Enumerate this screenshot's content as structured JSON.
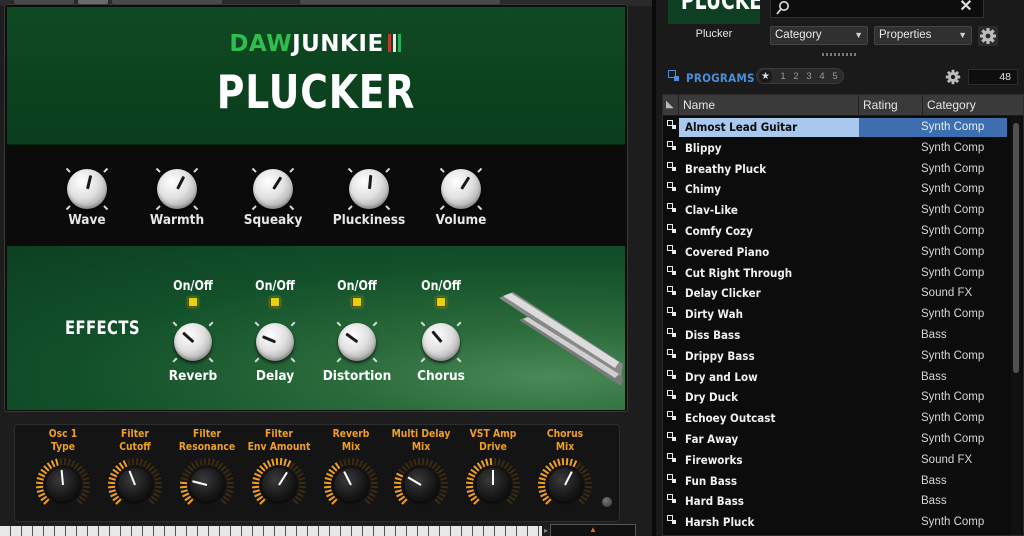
{
  "instrument": {
    "brand": {
      "part1": "DAW",
      "part2": "JUNKIE",
      "bar_colors": [
        "#c0392b",
        "#e8e8e8",
        "#27ae60"
      ]
    },
    "title": "PLUCKER",
    "main_knobs": [
      {
        "label": "Wave",
        "value": 0.55
      },
      {
        "label": "Warmth",
        "value": 0.6
      },
      {
        "label": "Squeaky",
        "value": 0.62
      },
      {
        "label": "Pluckiness",
        "value": 0.52
      },
      {
        "label": "Volume",
        "value": 0.62
      }
    ],
    "effects": {
      "title": "EFFECTS",
      "onoff_label": "On/Off",
      "units": [
        {
          "label": "Reverb",
          "value": 0.32
        },
        {
          "label": "Delay",
          "value": 0.25
        },
        {
          "label": "Distortion",
          "value": 0.3
        },
        {
          "label": "Chorus",
          "value": 0.35
        }
      ]
    },
    "bottom_knobs": [
      {
        "line1": "Osc 1",
        "line2": "Type",
        "value": 0.48
      },
      {
        "line1": "Filter",
        "line2": "Cutoff",
        "value": 0.42
      },
      {
        "line1": "Filter",
        "line2": "Resonance",
        "value": 0.22
      },
      {
        "line1": "Filter",
        "line2": "Env Amount",
        "value": 0.62
      },
      {
        "line1": "Reverb",
        "line2": "Mix",
        "value": 0.4
      },
      {
        "line1": "Multi Delay",
        "line2": "Mix",
        "value": 0.28
      },
      {
        "line1": "VST Amp",
        "line2": "Drive",
        "value": 0.5
      },
      {
        "line1": "Chorus",
        "line2": "Mix",
        "value": 0.6
      }
    ],
    "colors": {
      "accent_orange": "#f0a020",
      "led_yellow": "#e6d20a"
    }
  },
  "browser": {
    "preview_title": "PLUCKER",
    "preview_name": "Plucker",
    "search": {
      "value": "",
      "placeholder": ""
    },
    "filters": {
      "category": "Category",
      "properties": "Properties"
    },
    "programs_label": "PROGRAMS",
    "rating_filter": [
      "1",
      "2",
      "3",
      "4",
      "5"
    ],
    "program_count": "48",
    "columns": {
      "name": "Name",
      "rating": "Rating",
      "category": "Category"
    },
    "programs": [
      {
        "name": "Almost Lead Guitar",
        "category": "Synth Comp",
        "selected": true
      },
      {
        "name": "Blippy",
        "category": "Synth Comp"
      },
      {
        "name": "Breathy Pluck",
        "category": "Synth Comp"
      },
      {
        "name": "Chimy",
        "category": "Synth Comp"
      },
      {
        "name": "Clav-Like",
        "category": "Synth Comp"
      },
      {
        "name": "Comfy Cozy",
        "category": "Synth Comp"
      },
      {
        "name": "Covered Piano",
        "category": "Synth Comp"
      },
      {
        "name": "Cut Right Through",
        "category": "Synth Comp"
      },
      {
        "name": "Delay Clicker",
        "category": "Sound FX"
      },
      {
        "name": "Dirty Wah",
        "category": "Synth Comp"
      },
      {
        "name": "Diss Bass",
        "category": "Bass"
      },
      {
        "name": "Drippy Bass",
        "category": "Synth Comp"
      },
      {
        "name": "Dry and Low",
        "category": "Bass"
      },
      {
        "name": "Dry Duck",
        "category": "Synth Comp"
      },
      {
        "name": "Echoey Outcast",
        "category": "Synth Comp"
      },
      {
        "name": "Far Away",
        "category": "Synth Comp"
      },
      {
        "name": "Fireworks",
        "category": "Sound FX"
      },
      {
        "name": "Fun Bass",
        "category": "Bass"
      },
      {
        "name": "Hard Bass",
        "category": "Bass"
      },
      {
        "name": "Harsh Pluck",
        "category": "Synth Comp"
      }
    ],
    "colors": {
      "programs_blue": "#4a90d8",
      "selected_name_bg": "#a8c8ee",
      "selected_rest_bg": "#3d6fb0"
    }
  }
}
